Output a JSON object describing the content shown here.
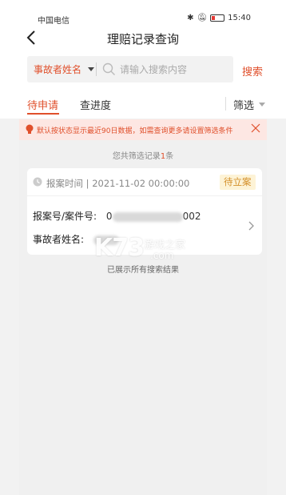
{
  "status_bar": {
    "carrier": "中国电信",
    "time": "15:40"
  },
  "nav": {
    "title": "理赔记录查询"
  },
  "search": {
    "filter_label": "事故者姓名",
    "placeholder": "请输入搜索内容",
    "button_label": "搜索"
  },
  "tabs": {
    "pending_label": "待申请",
    "progress_label": "查进度",
    "filter_label": "筛选"
  },
  "notice": {
    "text": "默认按状态显示最近90日数据，如需查询更多请设置筛选条件"
  },
  "result_count": {
    "prefix": "您共筛选记录",
    "count": "1",
    "suffix": "条"
  },
  "records": [
    {
      "report_time_label": "报案时间",
      "report_time": "2021-11-02 00:00:00",
      "status": "待立案",
      "case_no_label": "报案号/案件号:",
      "case_no_visible_start": "0",
      "case_no_visible_end": "002",
      "victim_name_label": "事故者姓名:"
    }
  ],
  "end_text": "已展示所有搜索结果",
  "watermark": {
    "logo": "K73",
    "name": "游戏之家",
    "domain": ".com"
  },
  "colors": {
    "accent": "#e0502c",
    "badge_bg": "#fdf3d6",
    "badge_text": "#d4902a",
    "notice_bg": "#fde7e3"
  }
}
